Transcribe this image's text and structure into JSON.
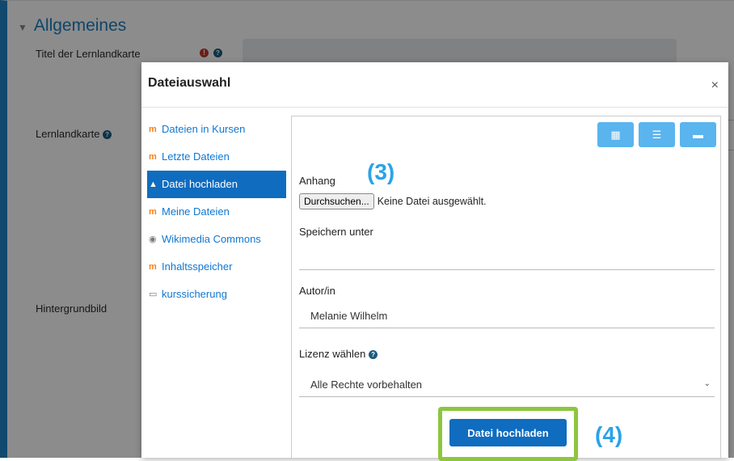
{
  "background": {
    "section_title": "Allgemeines",
    "fields": {
      "title_label": "Titel der Lernlandkarte",
      "map_label": "Lernlandkarte",
      "background_label": "Hintergrundbild",
      "required_icon": "exclamation-circle-icon",
      "help_icon": "question-circle-icon"
    },
    "edge_char": "A"
  },
  "dialog": {
    "title": "Dateiauswahl",
    "close_glyph": "×",
    "repositories": [
      {
        "label": "Dateien in Kursen",
        "icon": "moodle-icon"
      },
      {
        "label": "Letzte Dateien",
        "icon": "moodle-icon"
      },
      {
        "label": "Datei hochladen",
        "icon": "upload-icon",
        "active": true
      },
      {
        "label": "Meine Dateien",
        "icon": "moodle-icon"
      },
      {
        "label": "Wikimedia Commons",
        "icon": "wikimedia-icon"
      },
      {
        "label": "Inhaltsspeicher",
        "icon": "moodle-icon"
      },
      {
        "label": "kurssicherung",
        "icon": "backup-icon"
      }
    ],
    "view_buttons": [
      "icons-view",
      "list-view",
      "tree-view"
    ],
    "form": {
      "attachment_label": "Anhang",
      "browse_button": "Durchsuchen...",
      "no_file_text": "Keine Datei ausgewählt.",
      "save_as_label": "Speichern unter",
      "save_as_value": "",
      "author_label": "Autor/in",
      "author_value": "Melanie Wilhelm",
      "license_label": "Lizenz wählen",
      "license_value": "Alle Rechte vorbehalten",
      "upload_button": "Datei hochladen"
    },
    "annotations": {
      "step3": "(3)",
      "step4": "(4)"
    }
  },
  "colors": {
    "accent": "#0f6cbf",
    "highlight": "#8dc63f",
    "annotation": "#2aa3e8"
  }
}
